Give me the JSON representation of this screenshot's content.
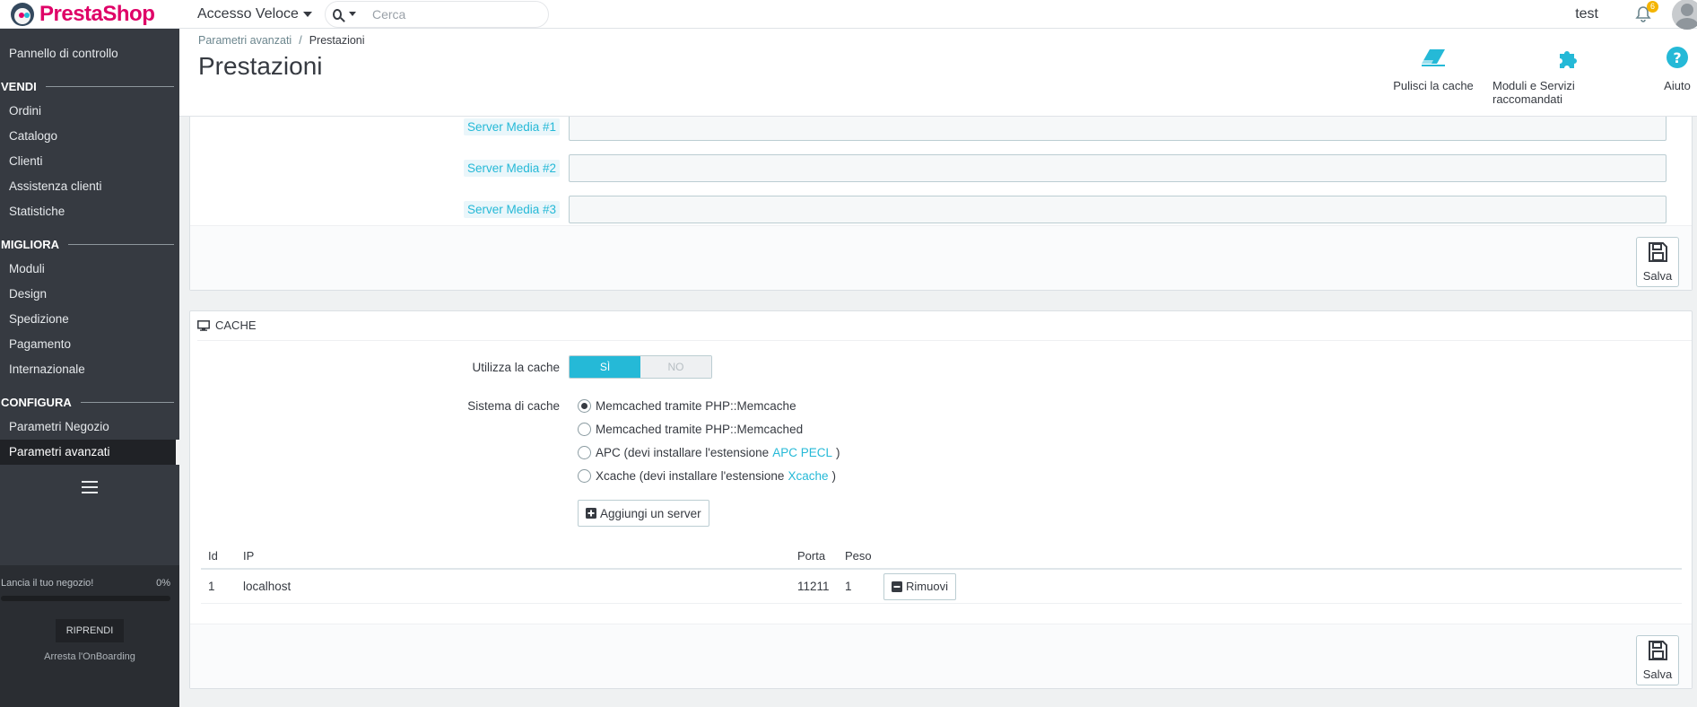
{
  "app": {
    "logo_text": "PrestaShop",
    "quick_access": "Accesso Veloce",
    "search_placeholder": "Cerca",
    "user_name": "test",
    "notifications_count": "6"
  },
  "sidebar": {
    "dashboard": "Pannello di controllo",
    "sections": [
      {
        "title": "VENDI",
        "items": [
          "Ordini",
          "Catalogo",
          "Clienti",
          "Assistenza clienti",
          "Statistiche"
        ]
      },
      {
        "title": "MIGLIORA",
        "items": [
          "Moduli",
          "Design",
          "Spedizione",
          "Pagamento",
          "Internazionale"
        ]
      },
      {
        "title": "CONFIGURA",
        "items": [
          "Parametri Negozio",
          "Parametri avanzati"
        ]
      }
    ],
    "active_item": "Parametri avanzati",
    "onboarding": {
      "label": "Lancia il tuo negozio!",
      "progress_percent": "0%",
      "progress_value": 0,
      "resume_button": "RIPRENDI",
      "stop_link": "Arresta l'OnBoarding"
    }
  },
  "header": {
    "breadcrumb_parent": "Parametri avanzati",
    "breadcrumb_current": "Prestazioni",
    "title": "Prestazioni",
    "toolbar": {
      "clear_cache": "Pulisci la cache",
      "modules": "Moduli e Servizi raccomandati",
      "help": "Aiuto"
    }
  },
  "media_servers": {
    "labels": [
      "Server Media #1",
      "Server Media #2",
      "Server Media #3"
    ],
    "values": [
      "",
      "",
      ""
    ],
    "save_label": "Salva"
  },
  "cache": {
    "heading": "CACHE",
    "use_cache_label": "Utilizza la cache",
    "toggle_on": "SÌ",
    "toggle_off": "NO",
    "toggle_value": true,
    "system_label": "Sistema di cache",
    "options": [
      {
        "text": "Memcached tramite PHP::Memcache",
        "checked": true
      },
      {
        "text": "Memcached tramite PHP::Memcached",
        "checked": false
      },
      {
        "text": "APC (devi installare l'estensione",
        "link": "APC PECL",
        "suffix": ")",
        "checked": false
      },
      {
        "text": "Xcache (devi installare l'estensione",
        "link": "Xcache",
        "suffix": ")",
        "checked": false
      }
    ],
    "add_server_label": "Aggiungi un server",
    "table": {
      "headers": {
        "id": "Id",
        "ip": "IP",
        "porta": "Porta",
        "peso": "Peso"
      },
      "rows": [
        {
          "id": "1",
          "ip": "localhost",
          "porta": "11211",
          "peso": "1",
          "remove": "Rimuovi"
        }
      ]
    },
    "save_label": "Salva"
  },
  "colors": {
    "accent": "#25b9d7",
    "brand": "#df0067",
    "sidebar": "#363a41"
  }
}
